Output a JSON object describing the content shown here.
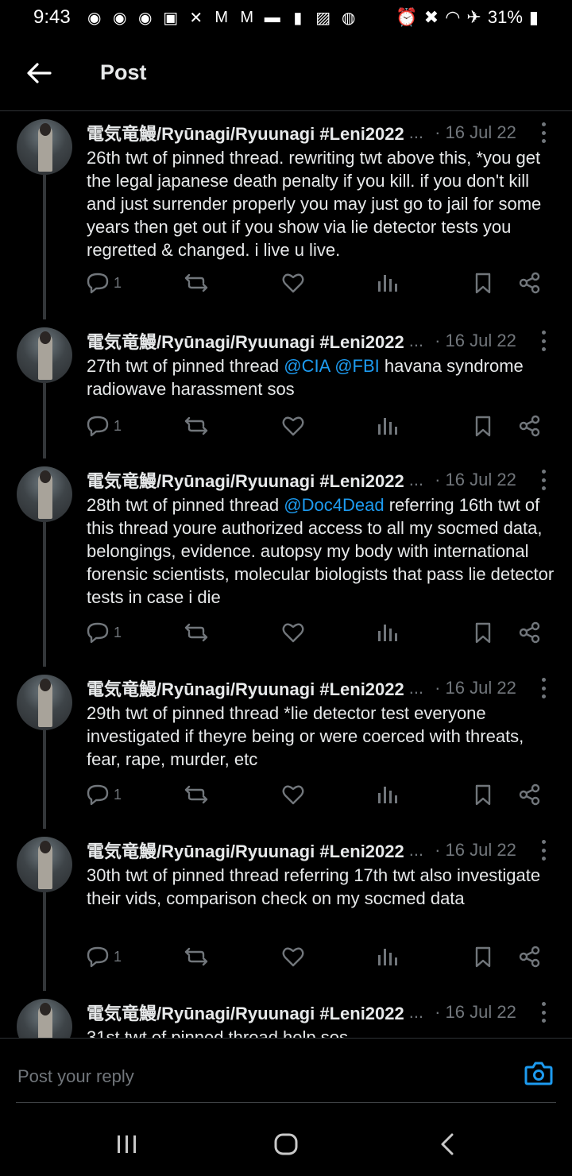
{
  "status_bar": {
    "time": "9:43",
    "battery": "31%"
  },
  "header": {
    "title": "Post"
  },
  "author": "電気竜鰻/Ryūnagi/Ryuunagi #Leni2022",
  "ellipsis": "...",
  "posts": [
    {
      "date": "· 16 Jul 22",
      "text_parts": [
        {
          "t": "26th twt of pinned thread. rewriting twt above this, *you get the legal japanese death penalty if you kill. if you don't kill and just surrender properly you may just go to jail for some years then get out if you show via lie detector tests you regretted & changed. i live u live."
        }
      ],
      "reply_count": "1"
    },
    {
      "date": "· 16 Jul 22",
      "text_parts": [
        {
          "t": "27th twt of pinned thread "
        },
        {
          "t": "@CIA",
          "mention": true
        },
        {
          "t": " "
        },
        {
          "t": "@FBI",
          "mention": true
        },
        {
          "t": " havana syndrome radiowave harassment sos"
        }
      ],
      "reply_count": "1"
    },
    {
      "date": "· 16 Jul 22",
      "text_parts": [
        {
          "t": "28th twt of pinned thread "
        },
        {
          "t": "@Doc4Dead",
          "mention": true
        },
        {
          "t": " referring 16th twt of this thread youre authorized access to all my socmed data, belongings, evidence. autopsy my body with international forensic scientists, molecular biologists that pass lie detector tests in case i die"
        }
      ],
      "reply_count": "1"
    },
    {
      "date": "· 16 Jul 22",
      "text_parts": [
        {
          "t": "29th twt of pinned thread *lie detector test everyone investigated if theyre being or were coerced with threats, fear, rape, murder, etc"
        }
      ],
      "reply_count": "1"
    },
    {
      "date": "· 16 Jul 22",
      "text_parts": [
        {
          "t": "30th twt of pinned thread referring 17th twt also investigate their vids, comparison check on my socmed data"
        }
      ],
      "reply_count": "1"
    },
    {
      "date": "· 16 Jul 22",
      "text_parts": [
        {
          "t": "31st twt of pinned thread help sos"
        }
      ],
      "reply_count": ""
    }
  ],
  "reply": {
    "placeholder": "Post your reply"
  },
  "icons": {
    "back": "arrow-left-icon",
    "more": "more-vertical-icon",
    "reply": "speech-bubble-icon",
    "repost": "repost-icon",
    "like": "heart-icon",
    "views": "bar-chart-icon",
    "bookmark": "bookmark-icon",
    "share": "share-icon",
    "camera": "camera-icon"
  },
  "colors": {
    "background": "#000000",
    "text": "#e7e9ea",
    "muted": "#71767b",
    "accent": "#1d9bf0"
  }
}
